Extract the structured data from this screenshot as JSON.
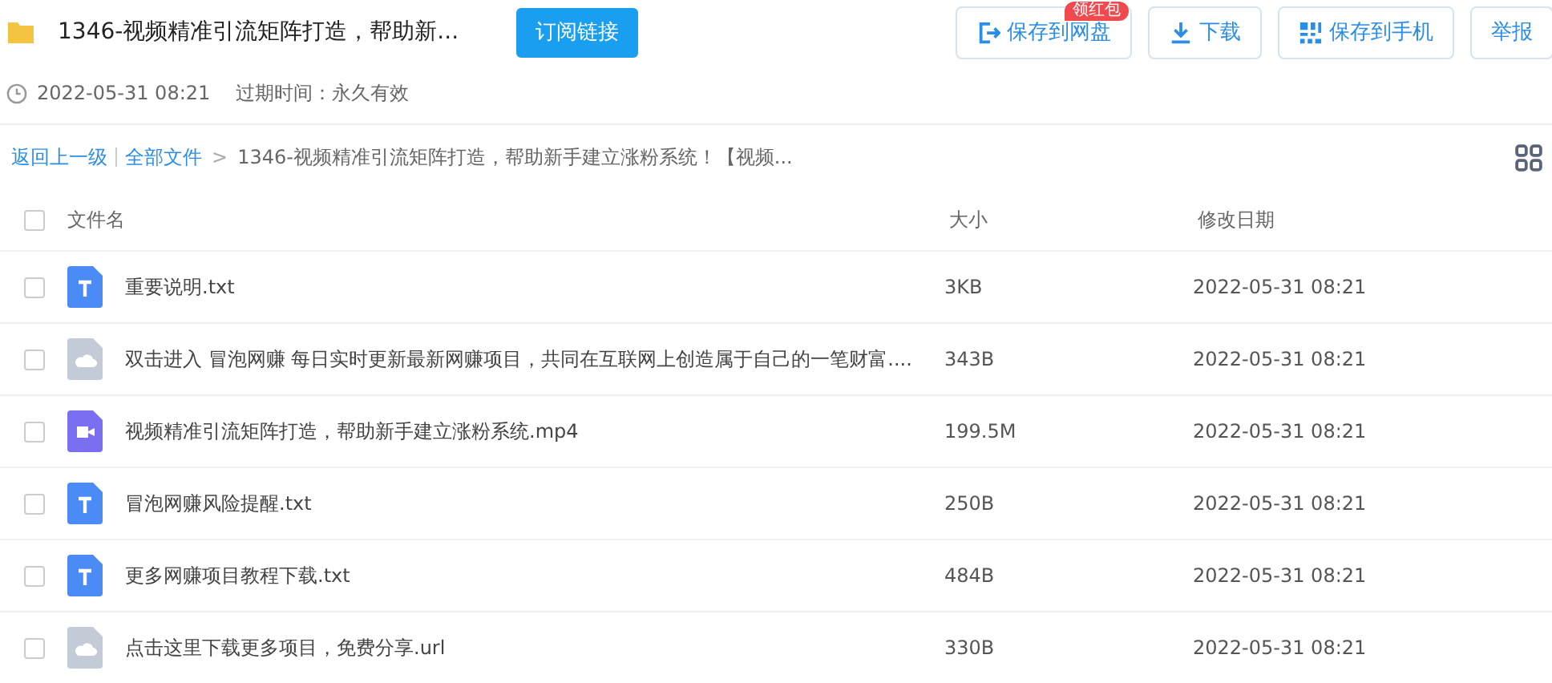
{
  "header": {
    "title": "1346-视频精准引流矩阵打造，帮助新...",
    "subscribe_button": "订阅链接",
    "actions": [
      {
        "kind": "save-cloud",
        "label": "保存到网盘",
        "badge": "领红包"
      },
      {
        "kind": "download",
        "label": "下载"
      },
      {
        "kind": "save-phone",
        "label": "保存到手机"
      },
      {
        "kind": "report",
        "label": "举报"
      }
    ],
    "date": "2022-05-31 08:21",
    "expiry": "过期时间：永久有效"
  },
  "breadcrumb": {
    "back": "返回上一级",
    "root": "全部文件",
    "separator": ">",
    "current": "1346-视频精准引流矩阵打造，帮助新手建立涨粉系统！【视频..."
  },
  "table": {
    "columns": [
      "文件名",
      "大小",
      "修改日期"
    ],
    "all_checked": false,
    "rows": [
      {
        "kind": "text",
        "name": "重要说明.txt",
        "size": "3KB",
        "date": "2022-05-31 08:21",
        "checked": false
      },
      {
        "kind": "link",
        "name": "双击进入 冒泡网赚 每日实时更新最新网赚项目，共同在互联网上创造属于自己的一笔财富....",
        "size": "343B",
        "date": "2022-05-31 08:21",
        "checked": false
      },
      {
        "kind": "video",
        "name": "视频精准引流矩阵打造，帮助新手建立涨粉系统.mp4",
        "size": "199.5M",
        "date": "2022-05-31 08:21",
        "checked": false
      },
      {
        "kind": "text",
        "name": "冒泡网赚风险提醒.txt",
        "size": "250B",
        "date": "2022-05-31 08:21",
        "checked": false
      },
      {
        "kind": "text",
        "name": "更多网赚项目教程下载.txt",
        "size": "484B",
        "date": "2022-05-31 08:21",
        "checked": false
      },
      {
        "kind": "link",
        "name": "点击这里下载更多项目，免费分享.url",
        "size": "330B",
        "date": "2022-05-31 08:21",
        "checked": false
      }
    ]
  }
}
